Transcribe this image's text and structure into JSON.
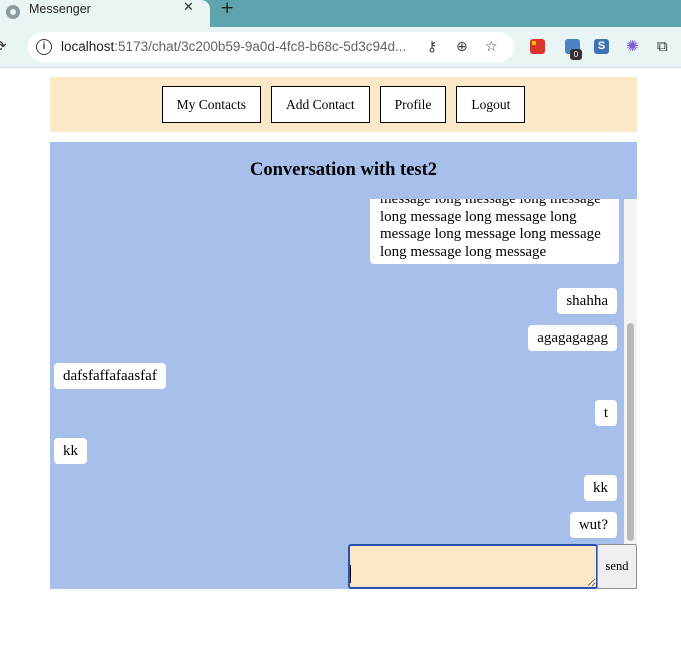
{
  "browser": {
    "tab_title": "Messenger",
    "tab_close": "✕",
    "new_tab": "+",
    "reload": "⟳",
    "url_host": "localhost",
    "url_rest": ":5173/chat/3c200b59-9a0d-4fc8-b68c-5d3c94d...",
    "icons": [
      "favicon-icon",
      "info-icon",
      "key-icon",
      "zoom-icon",
      "star-icon",
      "extension-icon",
      "puzzle-icon"
    ],
    "extension_badge": "0",
    "extension_s_label": "S"
  },
  "nav": {
    "buttons": [
      "My Contacts",
      "Add Contact",
      "Profile",
      "Logout"
    ]
  },
  "conversation": {
    "title": "Conversation with test2",
    "messages": [
      {
        "text": "message long message long message long message long message long message long message long message long message long message",
        "mine": true
      },
      {
        "text": "shahha",
        "mine": true
      },
      {
        "text": "agagagagag",
        "mine": true
      },
      {
        "text": "dafsfaffafaasfaf",
        "mine": false
      },
      {
        "text": "t",
        "mine": true
      },
      {
        "text": "kk",
        "mine": false
      },
      {
        "text": "kk",
        "mine": true
      },
      {
        "text": "wut?",
        "mine": true
      }
    ],
    "composer_value": "",
    "send_label": "send"
  },
  "colors": {
    "nav_bg": "#fae8c7",
    "chat_bg": "#a7bfeb",
    "composer_bg": "#fae8c7",
    "composer_border": "#2b4fb3"
  }
}
